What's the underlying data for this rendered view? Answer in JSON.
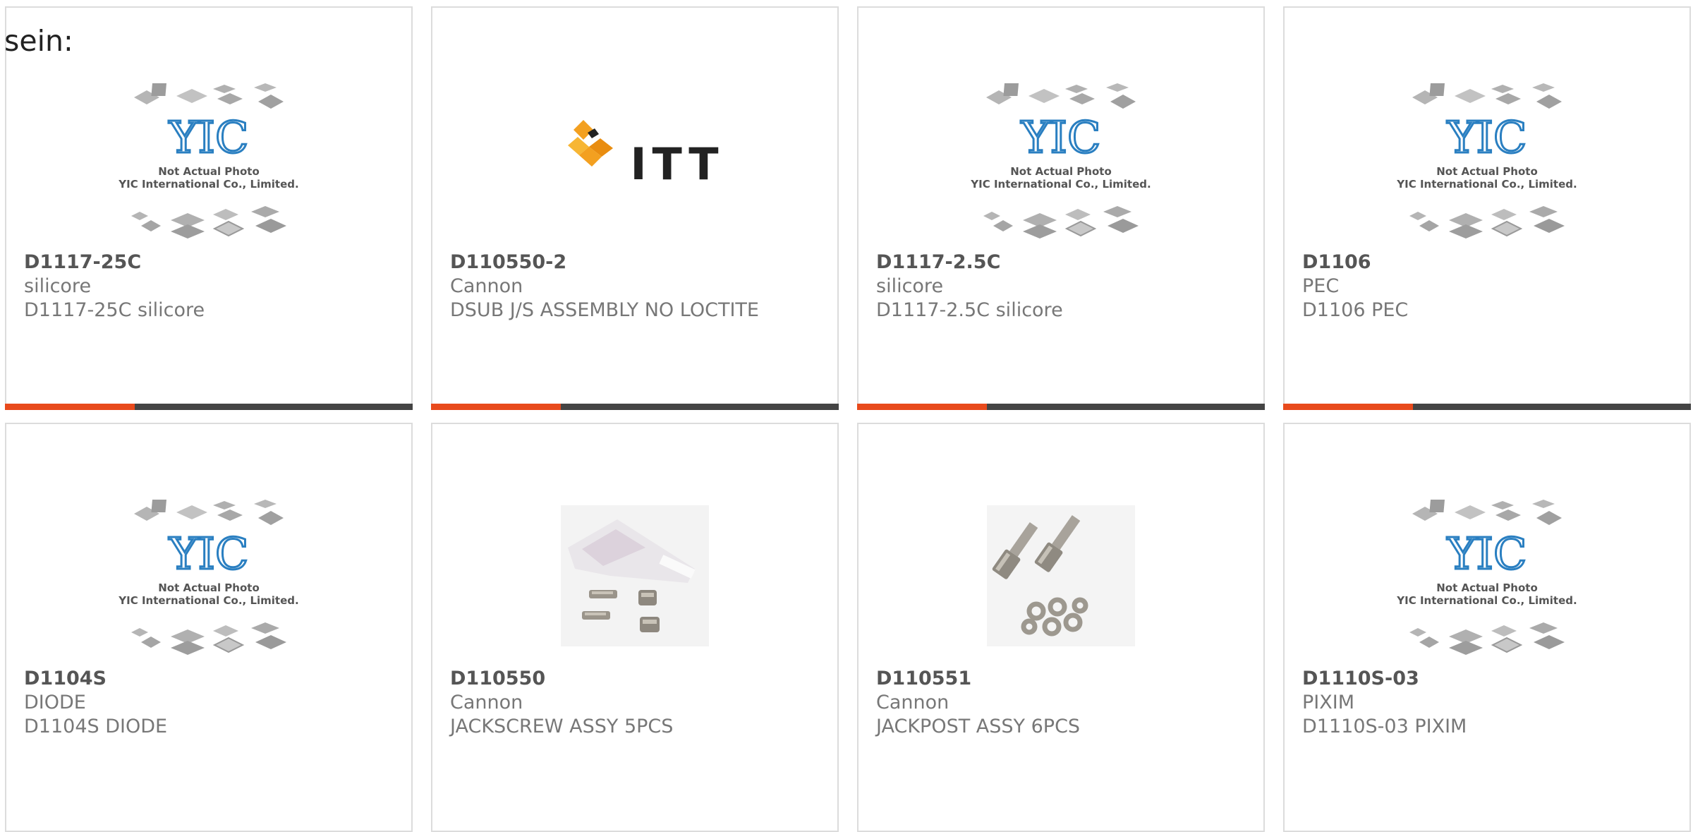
{
  "top_label": "sein:",
  "placeholder_caption": {
    "line1": "Not Actual Photo",
    "line2": "YIC International Co., Limited.",
    "logo": "YIC"
  },
  "itt_logo": "ITT",
  "products": [
    {
      "part": "D1117-25C",
      "mfr": "silicore",
      "desc": "D1117-25C silicore",
      "image": "placeholder"
    },
    {
      "part": "D110550-2",
      "mfr": "Cannon",
      "desc": "DSUB J/S ASSEMBLY NO LOCTITE",
      "image": "itt-logo"
    },
    {
      "part": "D1117-2.5C",
      "mfr": "silicore",
      "desc": "D1117-2.5C silicore",
      "image": "placeholder"
    },
    {
      "part": "D1106",
      "mfr": "PEC",
      "desc": "D1106 PEC",
      "image": "placeholder"
    },
    {
      "part": "D1104S",
      "mfr": "DIODE",
      "desc": "D1104S DIODE",
      "image": "placeholder"
    },
    {
      "part": "D110550",
      "mfr": "Cannon",
      "desc": "JACKSCREW ASSY 5PCS",
      "image": "jackscrew"
    },
    {
      "part": "D110551",
      "mfr": "Cannon",
      "desc": "JACKPOST ASSY 6PCS",
      "image": "jackpost"
    },
    {
      "part": "D1110S-03",
      "mfr": "PIXIM",
      "desc": "D1110S-03 PIXIM",
      "image": "placeholder"
    }
  ],
  "colors": {
    "accent": "#e84a1c",
    "bar_dark": "#444444",
    "yic_blue": "#2a7fc1"
  }
}
